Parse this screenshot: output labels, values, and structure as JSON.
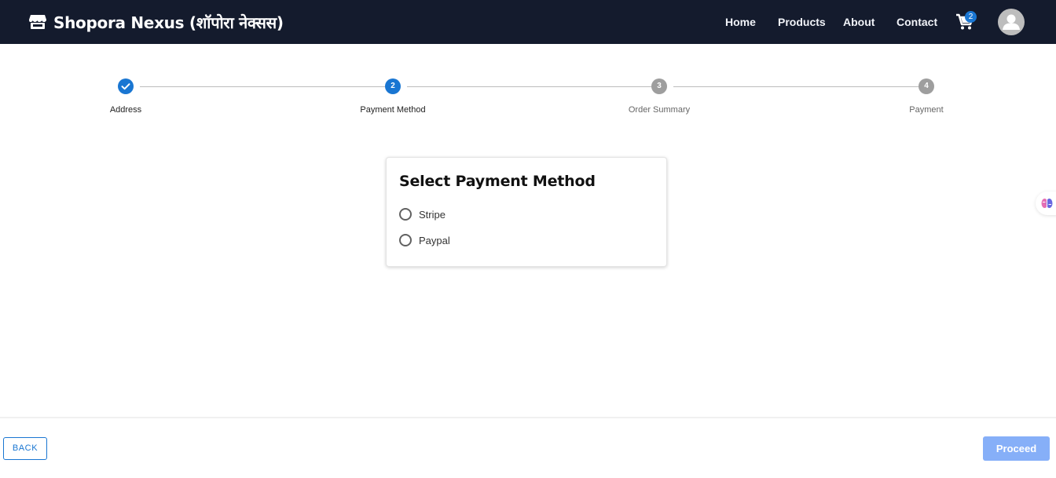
{
  "header": {
    "brand": "Shopora Nexus (शॉपोरा नेक्सस)",
    "nav": [
      "Home",
      "Products",
      "About",
      "Contact"
    ],
    "cart_count": "2",
    "cart_icon": "cart-icon",
    "avatar_icon": "user-avatar-icon"
  },
  "stepper": {
    "steps": [
      {
        "label": "Address",
        "marker": "✓",
        "state": "completed"
      },
      {
        "label": "Payment Method",
        "marker": "2",
        "state": "active"
      },
      {
        "label": "Order Summary",
        "marker": "3",
        "state": "pending"
      },
      {
        "label": "Payment",
        "marker": "4",
        "state": "pending"
      }
    ]
  },
  "payment": {
    "title": "Select Payment Method",
    "options": [
      "Stripe",
      "Paypal"
    ],
    "selected": null
  },
  "footer": {
    "back_label": "BACK",
    "proceed_label": "Proceed"
  },
  "colors": {
    "header_bg": "#141b2d",
    "accent": "#1976d2",
    "pending_step": "#9e9e9e",
    "proceed_disabled": "#86aff8"
  }
}
